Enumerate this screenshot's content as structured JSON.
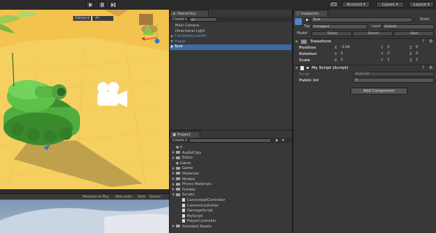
{
  "toolbar": {
    "account_label": "Account",
    "layers_label": "Layers",
    "layout_label": "Layout"
  },
  "scene": {
    "gizmos_label": "Gizmos",
    "search_placeholder": "All"
  },
  "game_bar": {
    "maximize_label": "Maximize on Play",
    "mute_label": "Mute audio",
    "stats_label": "Stats",
    "gizmos_label": "Gizmos"
  },
  "hierarchy": {
    "tab_label": "Hierarchy",
    "create_label": "Create",
    "search_placeholder": "All",
    "items": [
      "Main Camera",
      "Directional Light",
      "CompleteLevelArt",
      "Player",
      "Tank"
    ]
  },
  "project": {
    "tab_label": "Project",
    "create_label": "Create",
    "items": [
      {
        "label": "0",
        "type": "scene",
        "depth": 0
      },
      {
        "label": "AudioClips",
        "type": "folder",
        "depth": 0
      },
      {
        "label": "Editor",
        "type": "folder",
        "depth": 0
      },
      {
        "label": "Game",
        "type": "scene",
        "depth": 0
      },
      {
        "label": "Game",
        "type": "folder",
        "depth": 0
      },
      {
        "label": "Materials",
        "type": "folder",
        "depth": 0
      },
      {
        "label": "Models",
        "type": "folder",
        "depth": 0
      },
      {
        "label": "Physic Materials",
        "type": "folder",
        "depth": 0
      },
      {
        "label": "Prefabs",
        "type": "folder",
        "depth": 0
      },
      {
        "label": "Scripts",
        "type": "folder",
        "depth": 0
      },
      {
        "label": "CannonballController",
        "type": "script",
        "depth": 1
      },
      {
        "label": "CannonController",
        "type": "script",
        "depth": 1
      },
      {
        "label": "DamageScript",
        "type": "script",
        "depth": 1
      },
      {
        "label": "MyScript",
        "type": "script",
        "depth": 1
      },
      {
        "label": "PlayerController",
        "type": "script",
        "depth": 1
      },
      {
        "label": "Standard Assets",
        "type": "folder",
        "depth": 0
      }
    ]
  },
  "inspector": {
    "tab_label": "Inspector",
    "object_name": "Tank",
    "static_label": "Static",
    "tag_label": "Tag",
    "tag_value": "Untagged",
    "layer_label": "Layer",
    "layer_value": "Default",
    "model_label": "Model",
    "model_select": "Select",
    "model_revert": "Revert",
    "model_open": "Open",
    "transform_title": "Transform",
    "position_label": "Position",
    "rotation_label": "Rotation",
    "scale_label": "Scale",
    "x": "X",
    "y": "Y",
    "z": "Z",
    "position": [
      "-3.69",
      "0",
      "0"
    ],
    "rotation": [
      "0",
      "0",
      "0"
    ],
    "scale": [
      "1",
      "1",
      "1"
    ],
    "script_title": "My Script (Script)",
    "script_label": "Script",
    "script_value": "MyScript",
    "public_int_label": "Public Int",
    "public_int_value": "0",
    "add_component_label": "Add Component"
  },
  "colors": {
    "selection": "#3d6aa4",
    "panel_bg": "#383838",
    "sand": "#f5cf5f",
    "tank_green": "#4fae3f"
  }
}
